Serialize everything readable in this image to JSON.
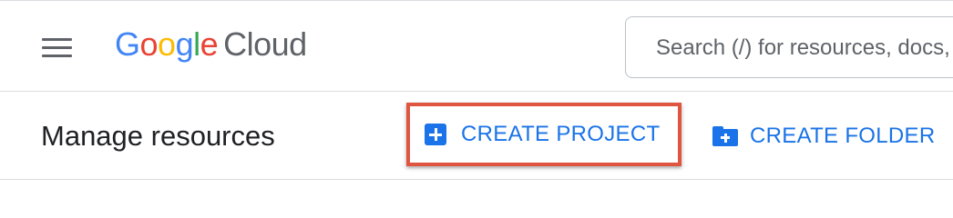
{
  "header": {
    "menu_icon": "hamburger-menu-icon",
    "logo": {
      "letters": [
        "G",
        "o",
        "o",
        "g",
        "l",
        "e"
      ],
      "product": "Cloud"
    },
    "search": {
      "placeholder": "Search (/) for resources, docs, products, and more",
      "value": ""
    }
  },
  "subbar": {
    "title": "Manage resources",
    "create_project": {
      "label": "CREATE PROJECT",
      "icon": "add-box-icon"
    },
    "create_folder": {
      "label": "CREATE FOLDER",
      "icon": "create-new-folder-icon"
    }
  },
  "colors": {
    "accent_blue": "#1a73e8",
    "highlight_border": "#e0553f",
    "google_blue": "#4285f4",
    "google_red": "#ea4335",
    "google_yellow": "#fbbc04",
    "google_green": "#34a853",
    "text_gray": "#5f6368"
  }
}
